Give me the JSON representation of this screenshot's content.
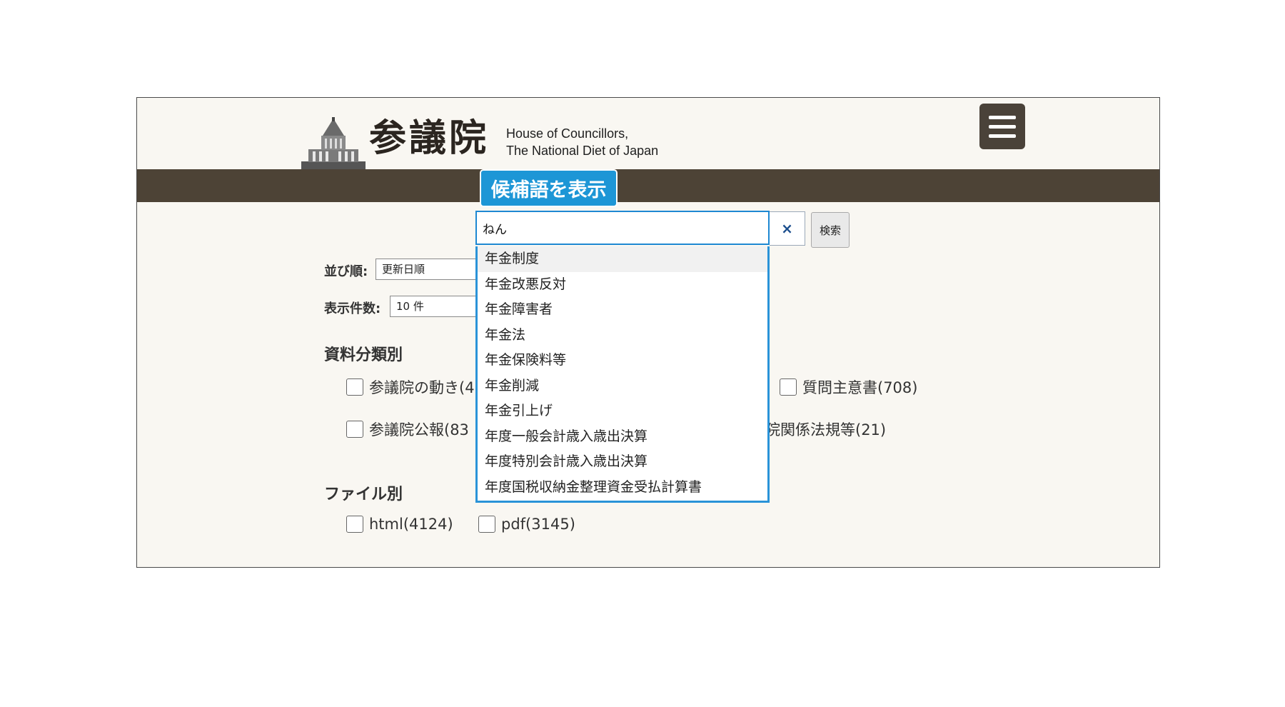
{
  "header": {
    "logo_kanji": "参議院",
    "logo_en_line1": "House of Councillors,",
    "logo_en_line2": "The National Diet of Japan"
  },
  "callout": {
    "text": "候補語を表示"
  },
  "search": {
    "value": "ねん",
    "clear_symbol": "×",
    "button_label": "検索"
  },
  "suggestions": [
    "年金制度",
    "年金改悪反対",
    "年金障害者",
    "年金法",
    "年金保険料等",
    "年金削減",
    "年金引上げ",
    "年度一般会計歳入歳出決算",
    "年度特別会計歳入歳出決算",
    "年度国税収納金整理資金受払計算書"
  ],
  "sort": {
    "label": "並び順:",
    "value": "更新日順"
  },
  "count": {
    "label": "表示件数:",
    "value": "10 件"
  },
  "material_section": {
    "title": "資料分類別",
    "items": [
      "参議院の動き(4",
      "質問主意書(708)",
      "参議院公報(83",
      "院関係法規等(21)"
    ]
  },
  "file_section": {
    "title": "ファイル別",
    "items": [
      "html(4124)",
      "pdf(3145)"
    ]
  },
  "colors": {
    "brown_band": "#4d4336",
    "callout_bg": "#1d96d6",
    "focus_border": "#1e88d2"
  }
}
